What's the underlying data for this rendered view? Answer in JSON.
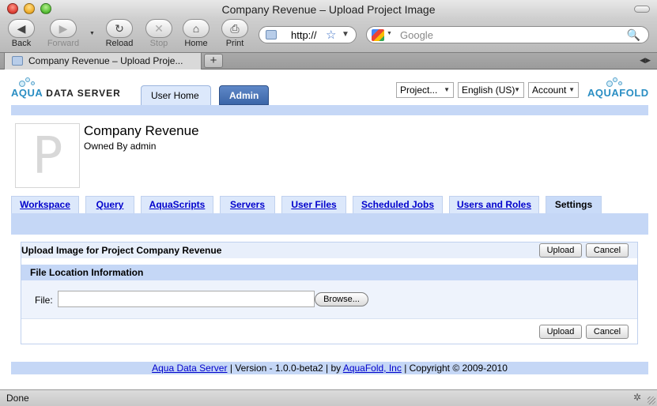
{
  "window": {
    "title": "Company Revenue – Upload Project Image"
  },
  "toolbar": {
    "back": {
      "label": "Back",
      "icon": "back-arrow-icon",
      "glyph": "◀"
    },
    "forward": {
      "label": "Forward",
      "icon": "forward-arrow-icon",
      "glyph": "▶"
    },
    "reload": {
      "label": "Reload",
      "icon": "reload-icon",
      "glyph": "↻"
    },
    "stop": {
      "label": "Stop",
      "icon": "stop-icon",
      "glyph": "✕"
    },
    "home": {
      "label": "Home",
      "icon": "home-icon",
      "glyph": "⌂"
    },
    "print": {
      "label": "Print",
      "icon": "printer-icon",
      "glyph": "⎙"
    }
  },
  "address": {
    "value": "http://",
    "star": "☆",
    "dropdown": "▼"
  },
  "search": {
    "placeholder": "Google",
    "glass": "🔍"
  },
  "browser_tabs": [
    {
      "title": "Company Revenue – Upload Proje..."
    }
  ],
  "newtab_label": "+",
  "app": {
    "logo_left": {
      "aqua": "AQUA",
      "rest": "DATA SERVER"
    },
    "logo_right": {
      "aqua": "AQUA",
      "fold": "FOLD"
    },
    "tabs": [
      {
        "label": "User Home"
      },
      {
        "label": "Admin"
      }
    ],
    "selectors": [
      {
        "label": "Project..."
      },
      {
        "label": "English (US)"
      },
      {
        "label": "Account"
      }
    ],
    "select_caret": "▼"
  },
  "project": {
    "title": "Company Revenue",
    "owner": "Owned By admin",
    "thumb_letter": "P"
  },
  "nav_tabs": [
    {
      "label": "Workspace"
    },
    {
      "label": "Query"
    },
    {
      "label": "AquaScripts"
    },
    {
      "label": "Servers"
    },
    {
      "label": "User Files"
    },
    {
      "label": "Scheduled Jobs"
    },
    {
      "label": "Users and Roles"
    },
    {
      "label": "Settings"
    }
  ],
  "upload_panel": {
    "title": "Upload Image for Project Company Revenue",
    "upload_label": "Upload",
    "cancel_label": "Cancel",
    "section_title": "File Location Information",
    "file_label": "File:",
    "file_value": "",
    "browse_label": "Browse..."
  },
  "footer": {
    "link1": "Aqua Data Server",
    "text1": " | Version - 1.0.0-beta2 | by ",
    "link2": "AquaFold, Inc",
    "text2": " | Copyright © 2009-2010"
  },
  "status": {
    "text": "Done"
  },
  "colors": {
    "accent_blue": "#2a8ec3",
    "band_blue": "#c5d7f6",
    "admin_tab": "#3c66a8",
    "link": "#0000cc"
  }
}
